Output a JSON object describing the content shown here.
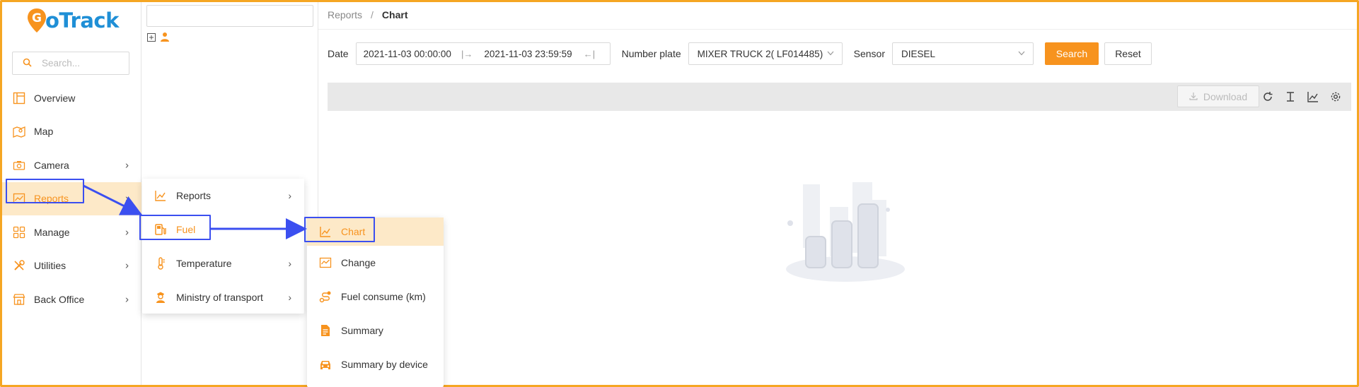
{
  "app": {
    "brand_g": "G",
    "brand_rest": "oTrack"
  },
  "sidebar": {
    "search_placeholder": "Search...",
    "items": [
      {
        "label": "Overview",
        "icon": "layout-icon",
        "has_children": false
      },
      {
        "label": "Map",
        "icon": "map-icon",
        "has_children": false
      },
      {
        "label": "Camera",
        "icon": "camera-icon",
        "has_children": true
      },
      {
        "label": "Reports",
        "icon": "chart-icon",
        "has_children": true,
        "active": true
      },
      {
        "label": "Manage",
        "icon": "grid-icon",
        "has_children": true
      },
      {
        "label": "Utilities",
        "icon": "tools-icon",
        "has_children": true
      },
      {
        "label": "Back Office",
        "icon": "store-icon",
        "has_children": true
      }
    ]
  },
  "reports_submenu": {
    "items": [
      {
        "label": "Reports",
        "icon": "line-chart-icon",
        "has_children": true
      },
      {
        "label": "Fuel",
        "icon": "fuel-pump-icon",
        "has_children": false,
        "highlighted": true
      },
      {
        "label": "Temperature",
        "icon": "thermometer-icon",
        "has_children": true
      },
      {
        "label": "Ministry of transport",
        "icon": "officer-icon",
        "has_children": true
      }
    ]
  },
  "fuel_submenu": {
    "items": [
      {
        "label": "Chart",
        "icon": "line-chart-icon",
        "selected": true
      },
      {
        "label": "Change",
        "icon": "chart-box-icon"
      },
      {
        "label": "Fuel consume (km)",
        "icon": "route-icon"
      },
      {
        "label": "Summary",
        "icon": "document-icon"
      },
      {
        "label": "Summary by device",
        "icon": "car-icon"
      }
    ]
  },
  "breadcrumb": {
    "parent": "Reports",
    "separator": "/",
    "current": "Chart"
  },
  "filters": {
    "date_label": "Date",
    "date_start": "2021-11-03 00:00:00",
    "date_end": "2021-11-03 23:59:59",
    "plate_label": "Number plate",
    "plate_value": "MIXER TRUCK 2( LF014485)",
    "sensor_label": "Sensor",
    "sensor_value": "DIESEL",
    "search_button": "Search",
    "reset_button": "Reset"
  },
  "chart_toolbar": {
    "download_label": "Download"
  },
  "colors": {
    "accent": "#f7931e",
    "brand_blue": "#1f8fd6",
    "annotation": "#3b4ff0",
    "active_bg": "#fde9c8"
  }
}
